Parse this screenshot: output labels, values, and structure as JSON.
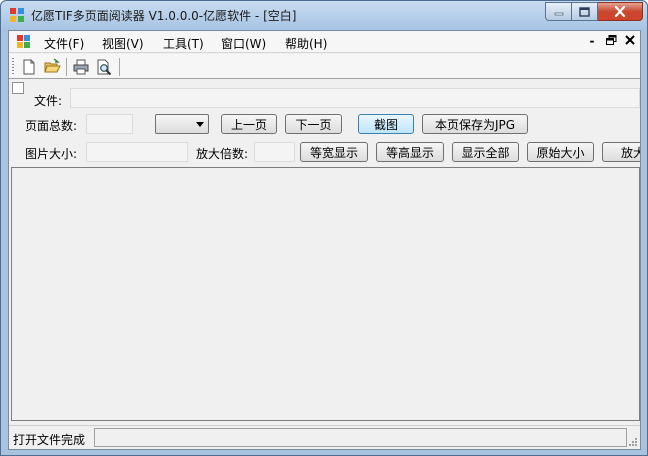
{
  "window": {
    "title": "亿愿TIF多页面阅读器 V1.0.0.0-亿愿软件 - [空白]",
    "minimize_glyph": "—",
    "maximize_glyph": "□",
    "close_glyph": "✕"
  },
  "menu": {
    "items": [
      "文件(F)",
      "视图(V)",
      "工具(T)",
      "窗口(W)",
      "帮助(H)"
    ],
    "mdi_minimize": "-",
    "mdi_restore": "🗗",
    "mdi_close": "✕"
  },
  "toolbar": {
    "buttons": [
      "new-document-icon",
      "open-folder-icon",
      "print-icon",
      "print-preview-icon"
    ]
  },
  "form": {
    "file_label": "文件:",
    "file_value": "",
    "total_pages_label": "页面总数:",
    "total_pages_value": "",
    "page_select_value": "",
    "prev_page": "上一页",
    "next_page": "下一页",
    "screenshot": "截图",
    "save_jpg": "本页保存为JPG",
    "image_size_label": "图片大小:",
    "image_size_value": "",
    "zoom_label": "放大倍数:",
    "zoom_value": "",
    "fit_width": "等宽显示",
    "fit_height": "等高显示",
    "show_all": "显示全部",
    "original_size": "原始大小",
    "zoom_in": "放大"
  },
  "status": {
    "text": "打开文件完成",
    "panel_value": ""
  },
  "colors": {
    "titlebar": "#b9d1ea",
    "close_button": "#c7472f",
    "client_bg": "#f0f0f0"
  }
}
